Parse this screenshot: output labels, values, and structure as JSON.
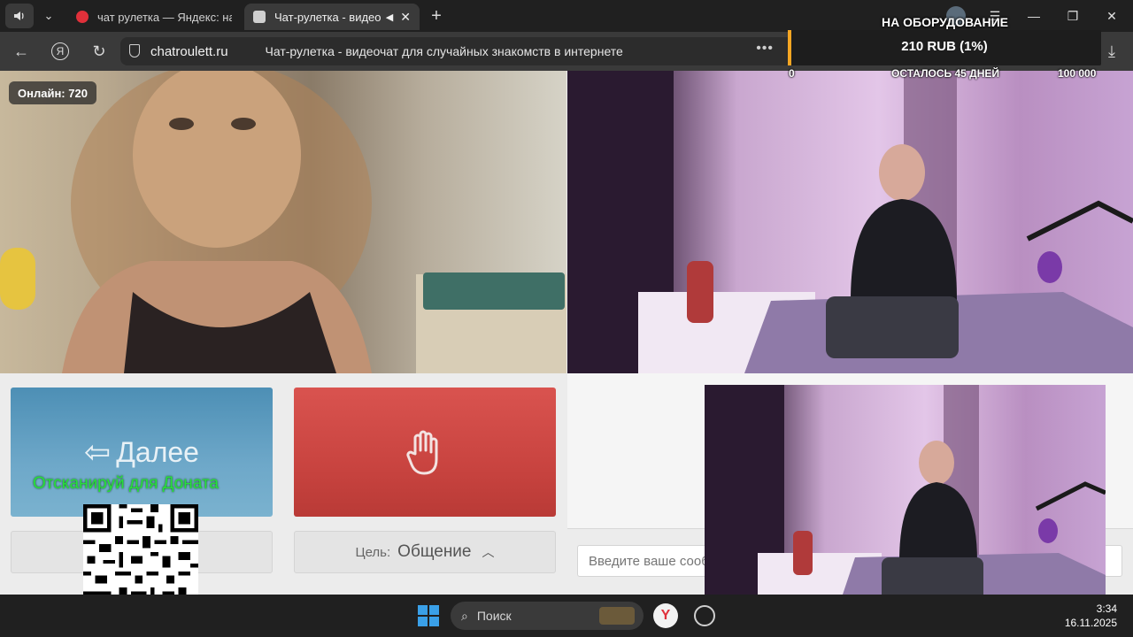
{
  "tabs": [
    {
      "label": "чат рулетка — Яндекс: на",
      "active": false
    },
    {
      "label": "Чат-рулетка - видео",
      "active": true
    }
  ],
  "address": {
    "domain": "chatroulett.ru",
    "title": "Чат-рулетка - видеочат для случайных знакомств в интернете"
  },
  "donation": {
    "heading": "НА ОБОРУДОВАНИЕ",
    "amount": "210 RUB (1%)",
    "progress_percent": 1,
    "min_label": "0",
    "remaining_label": "ОСТАЛОСЬ 45 ДНЕЙ",
    "max_label": "100 000"
  },
  "page": {
    "online_label": "Онлайн: 720",
    "next_label": "Далее",
    "goal_label": "Цель:",
    "goal_value": "Общение",
    "message_placeholder": "Введите ваше сообщение"
  },
  "overlay": {
    "scan_text": "Отсканируй для Доната"
  },
  "taskbar": {
    "search_label": "Поиск",
    "time": "3:34",
    "date": "16.11.2025"
  },
  "colors": {
    "accent": "#f5a623",
    "next_button": "#5a9bc0",
    "stop_button": "#c94440",
    "scan_text": "#27e03a"
  }
}
